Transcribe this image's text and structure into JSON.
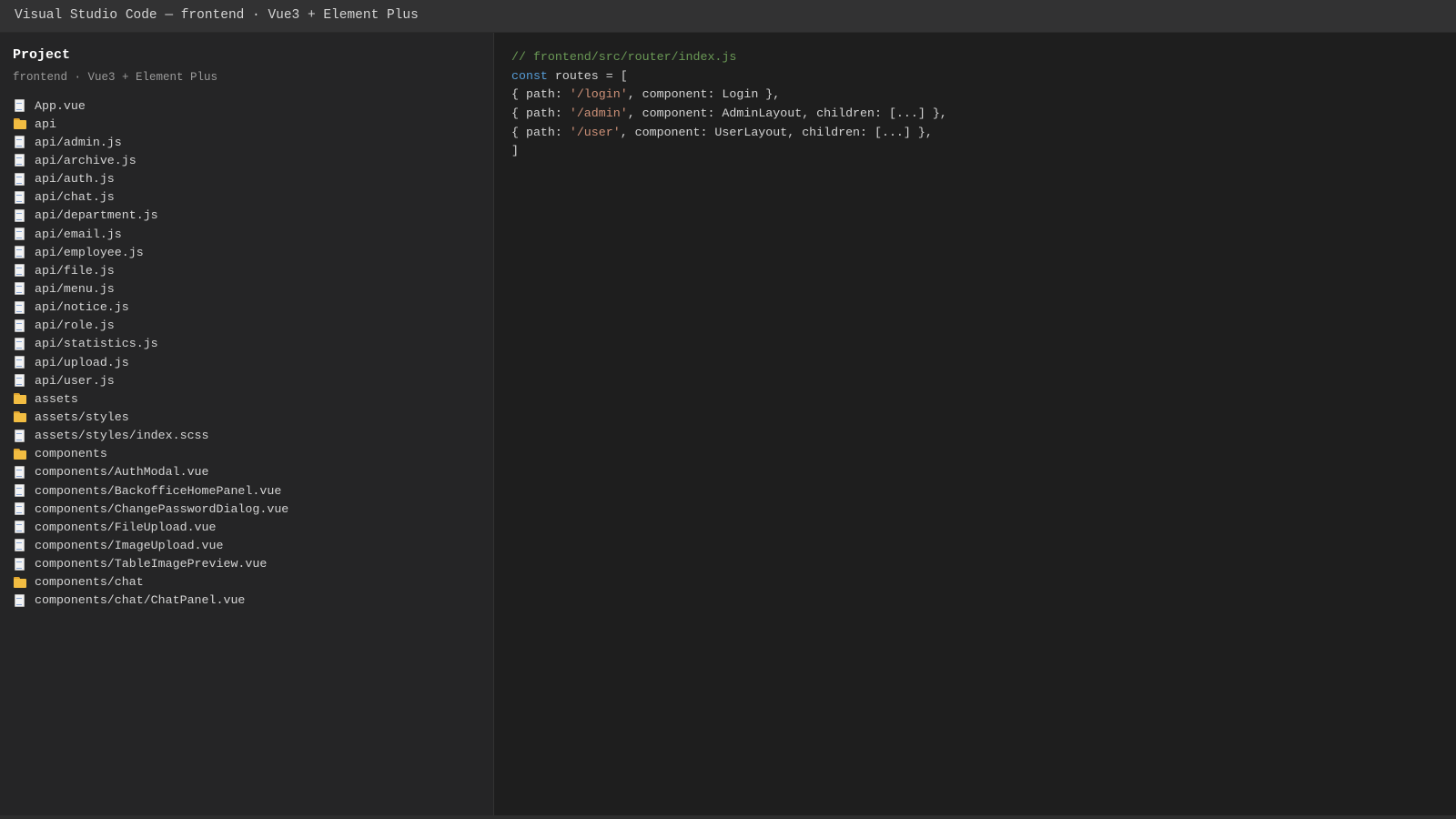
{
  "window": {
    "title": "Visual Studio Code — frontend · Vue3 + Element Plus"
  },
  "sidebar": {
    "heading": "Project",
    "subheading": "frontend · Vue3 + Element Plus",
    "items": [
      {
        "label": "App.vue",
        "icon": "file-icon"
      },
      {
        "label": "api",
        "icon": "folder-icon"
      },
      {
        "label": "api/admin.js",
        "icon": "file-icon"
      },
      {
        "label": "api/archive.js",
        "icon": "file-icon"
      },
      {
        "label": "api/auth.js",
        "icon": "file-icon"
      },
      {
        "label": "api/chat.js",
        "icon": "file-icon"
      },
      {
        "label": "api/department.js",
        "icon": "file-icon"
      },
      {
        "label": "api/email.js",
        "icon": "file-icon"
      },
      {
        "label": "api/employee.js",
        "icon": "file-icon"
      },
      {
        "label": "api/file.js",
        "icon": "file-icon"
      },
      {
        "label": "api/menu.js",
        "icon": "file-icon"
      },
      {
        "label": "api/notice.js",
        "icon": "file-icon"
      },
      {
        "label": "api/role.js",
        "icon": "file-icon"
      },
      {
        "label": "api/statistics.js",
        "icon": "file-icon"
      },
      {
        "label": "api/upload.js",
        "icon": "file-icon"
      },
      {
        "label": "api/user.js",
        "icon": "file-icon"
      },
      {
        "label": "assets",
        "icon": "folder-icon"
      },
      {
        "label": "assets/styles",
        "icon": "folder-icon"
      },
      {
        "label": "assets/styles/index.scss",
        "icon": "file-icon"
      },
      {
        "label": "components",
        "icon": "folder-icon"
      },
      {
        "label": "components/AuthModal.vue",
        "icon": "file-icon"
      },
      {
        "label": "components/BackofficeHomePanel.vue",
        "icon": "file-icon"
      },
      {
        "label": "components/ChangePasswordDialog.vue",
        "icon": "file-icon"
      },
      {
        "label": "components/FileUpload.vue",
        "icon": "file-icon"
      },
      {
        "label": "components/ImageUpload.vue",
        "icon": "file-icon"
      },
      {
        "label": "components/TableImagePreview.vue",
        "icon": "file-icon"
      },
      {
        "label": "components/chat",
        "icon": "folder-icon"
      },
      {
        "label": "components/chat/ChatPanel.vue",
        "icon": "file-icon"
      }
    ]
  },
  "editor": {
    "lines": [
      [
        {
          "t": "// frontend/src/router/index.js",
          "c": "comment"
        }
      ],
      [
        {
          "t": "const",
          "c": "keyword"
        },
        {
          "t": " routes = [",
          "c": "plain"
        }
      ],
      [
        {
          "t": "{ path: ",
          "c": "plain"
        },
        {
          "t": "'/login'",
          "c": "string"
        },
        {
          "t": ", component: Login },",
          "c": "plain"
        }
      ],
      [
        {
          "t": "{ path: ",
          "c": "plain"
        },
        {
          "t": "'/admin'",
          "c": "string"
        },
        {
          "t": ", component: AdminLayout, children: [...] },",
          "c": "plain"
        }
      ],
      [
        {
          "t": "{ path: ",
          "c": "plain"
        },
        {
          "t": "'/user'",
          "c": "string"
        },
        {
          "t": ", component: UserLayout, children: [...] },",
          "c": "plain"
        }
      ],
      [
        {
          "t": "]",
          "c": "plain"
        }
      ]
    ]
  },
  "colors": {
    "comment": "#6a9955",
    "keyword": "#569cd6",
    "string": "#ce9178",
    "plain": "#d4d4d4",
    "folder": "#f2bd42"
  }
}
